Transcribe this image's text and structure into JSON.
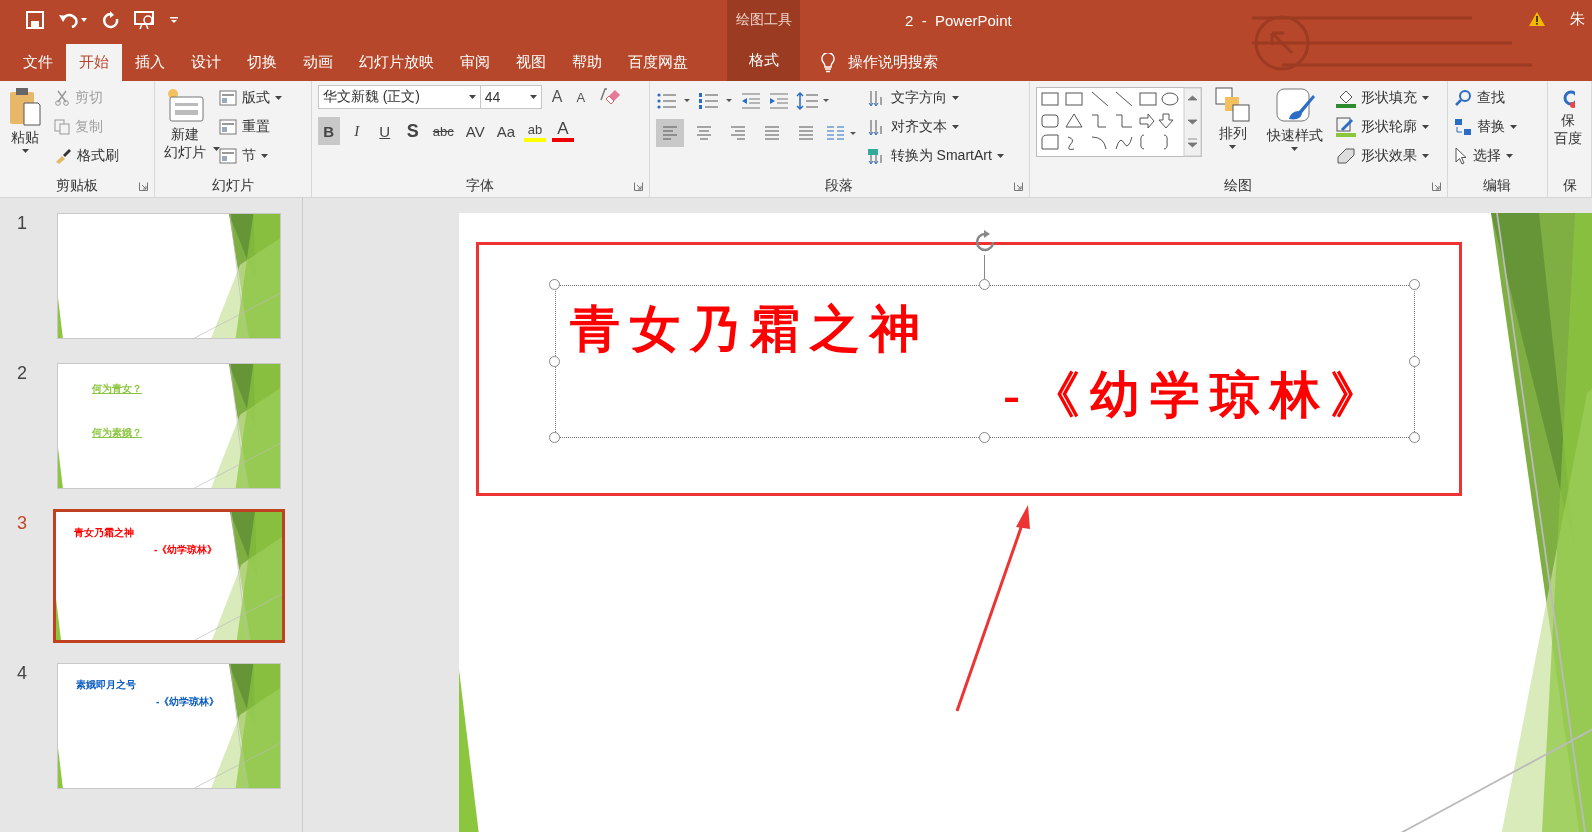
{
  "window": {
    "context_label": "绘图工具",
    "title": "2  -  PowerPoint",
    "user": "朱"
  },
  "tabs": [
    {
      "label": "文件",
      "selected": false
    },
    {
      "label": "开始",
      "selected": true
    },
    {
      "label": "插入",
      "selected": false
    },
    {
      "label": "设计",
      "selected": false
    },
    {
      "label": "切换",
      "selected": false
    },
    {
      "label": "动画",
      "selected": false
    },
    {
      "label": "幻灯片放映",
      "selected": false
    },
    {
      "label": "审阅",
      "selected": false
    },
    {
      "label": "视图",
      "selected": false
    },
    {
      "label": "帮助",
      "selected": false
    },
    {
      "label": "百度网盘",
      "selected": false
    }
  ],
  "context_tab": {
    "label": "格式"
  },
  "tell_me": {
    "placeholder": "操作说明搜索"
  },
  "ribbon": {
    "clipboard": {
      "label": "剪贴板",
      "paste": "粘贴",
      "items": [
        {
          "label": "剪切",
          "disabled": true
        },
        {
          "label": "复制",
          "disabled": true
        },
        {
          "label": "格式刷",
          "disabled": false
        }
      ]
    },
    "slides": {
      "label": "幻灯片",
      "new_slide": [
        "新建",
        "幻灯片"
      ],
      "items": [
        "版式",
        "重置",
        "节"
      ]
    },
    "font": {
      "label": "字体",
      "font_name": "华文新魏 (正文)",
      "font_size": "44",
      "size_buttons": [
        "A",
        "A"
      ],
      "format_buttons": [
        {
          "label": "B",
          "selected": true
        },
        {
          "label": "I",
          "selected": false
        },
        {
          "label": "U",
          "selected": false
        },
        {
          "label": "S",
          "selected": false
        },
        {
          "label": "abc",
          "selected": false
        },
        {
          "label": "AV",
          "selected": false
        },
        {
          "label": "Aa",
          "selected": false
        }
      ],
      "highlight": "ab",
      "font_color": "A"
    },
    "paragraph": {
      "label": "段落",
      "items": [
        "文字方向",
        "对齐文本",
        "转换为 SmartArt"
      ],
      "align": [
        {
          "selected": true
        },
        {
          "selected": false
        },
        {
          "selected": false
        },
        {
          "selected": false
        },
        {
          "selected": false
        }
      ]
    },
    "drawing": {
      "label": "绘图",
      "arrange": "排列",
      "quick_styles": "快速样式",
      "items": [
        "形状填充",
        "形状轮廓",
        "形状效果"
      ]
    },
    "editing": {
      "label": "编辑",
      "items": [
        "查找",
        "替换",
        "选择"
      ]
    },
    "save": {
      "label": "保",
      "button": [
        "保",
        "百度"
      ]
    }
  },
  "thumbnails": [
    {
      "number": "1",
      "selected": false
    },
    {
      "number": "2",
      "selected": false,
      "texts": [
        {
          "text": "何为青女？",
          "color": "#8cc63f",
          "underlined": true
        },
        {
          "text": "何为素娥？",
          "color": "#8cc63f",
          "underlined": true
        }
      ]
    },
    {
      "number": "3",
      "selected": true,
      "texts": [
        {
          "text": "青女乃霜之神",
          "color": "#ff0000",
          "underlined": false
        },
        {
          "text": "-《幼学琼林》",
          "color": "#ff0000",
          "underlined": false
        }
      ]
    },
    {
      "number": "4",
      "selected": false,
      "texts": [
        {
          "text": "素娥即月之号",
          "color": "#0b5cc0",
          "underlined": false
        },
        {
          "text": "-《幼学琼林》",
          "color": "#0b5cc0",
          "underlined": false
        }
      ]
    }
  ],
  "slide": {
    "text_box": {
      "selected": true,
      "color": "#ff0000",
      "lines": [
        "青女乃霜之神",
        "-《幼学琼林》"
      ]
    }
  }
}
